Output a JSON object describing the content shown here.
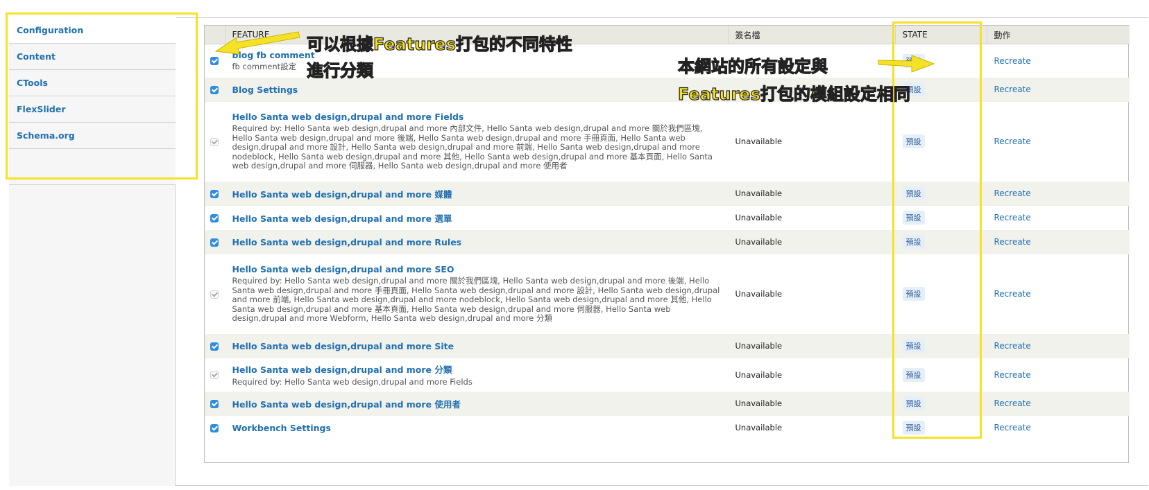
{
  "tabs": [
    {
      "label": "Configuration",
      "active": true
    },
    {
      "label": "Content",
      "active": false
    },
    {
      "label": "CTools",
      "active": false
    },
    {
      "label": "FlexSlider",
      "active": false
    },
    {
      "label": "Schema.org",
      "active": false
    }
  ],
  "table": {
    "headers": {
      "feature": "FEATURE",
      "signature": "簽名檔",
      "state": "STATE",
      "actions": "動作"
    },
    "rows": [
      {
        "checked": true,
        "disabled": false,
        "name": "blog fb comment",
        "desc": "fb comment設定",
        "signature": "",
        "state": "預設",
        "action": "Recreate"
      },
      {
        "checked": true,
        "disabled": false,
        "name": "Blog Settings",
        "desc": "",
        "signature": "",
        "state": "預設",
        "action": "Recreate"
      },
      {
        "checked": true,
        "disabled": true,
        "name": "Hello Santa web design,drupal and more Fields",
        "desc": "Required by: Hello Santa web design,drupal and more 內部文件, Hello Santa web design,drupal and more 關於我們區塊, Hello Santa web design,drupal and more 後端, Hello Santa web design,drupal and more 手冊頁面, Hello Santa web design,drupal and more 設計, Hello Santa web design,drupal and more 前端, Hello Santa web design,drupal and more nodeblock, Hello Santa web design,drupal and more 其他, Hello Santa web design,drupal and more 基本頁面, Hello Santa web design,drupal and more 伺服器, Hello Santa web design,drupal and more 使用者",
        "signature": "Unavailable",
        "state": "預設",
        "action": "Recreate"
      },
      {
        "checked": true,
        "disabled": false,
        "name": "Hello Santa web design,drupal and more 媒體",
        "desc": "",
        "signature": "Unavailable",
        "state": "預設",
        "action": "Recreate"
      },
      {
        "checked": true,
        "disabled": false,
        "name": "Hello Santa web design,drupal and more 選單",
        "desc": "",
        "signature": "Unavailable",
        "state": "預設",
        "action": "Recreate"
      },
      {
        "checked": true,
        "disabled": false,
        "name": "Hello Santa web design,drupal and more Rules",
        "desc": "",
        "signature": "Unavailable",
        "state": "預設",
        "action": "Recreate"
      },
      {
        "checked": true,
        "disabled": true,
        "name": "Hello Santa web design,drupal and more SEO",
        "desc": "Required by: Hello Santa web design,drupal and more 關於我們區塊, Hello Santa web design,drupal and more 後端, Hello Santa web design,drupal and more 手冊頁面, Hello Santa web design,drupal and more 設計, Hello Santa web design,drupal and more 前端, Hello Santa web design,drupal and more nodeblock, Hello Santa web design,drupal and more 其他, Hello Santa web design,drupal and more 基本頁面, Hello Santa web design,drupal and more 伺服器, Hello Santa web design,drupal and more Webform, Hello Santa web design,drupal and more 分類",
        "signature": "Unavailable",
        "state": "預設",
        "action": "Recreate"
      },
      {
        "checked": true,
        "disabled": false,
        "name": "Hello Santa web design,drupal and more Site",
        "desc": "",
        "signature": "Unavailable",
        "state": "預設",
        "action": "Recreate"
      },
      {
        "checked": true,
        "disabled": true,
        "name": "Hello Santa web design,drupal and more 分類",
        "desc": "Required by: Hello Santa web design,drupal and more Fields",
        "signature": "Unavailable",
        "state": "預設",
        "action": "Recreate"
      },
      {
        "checked": true,
        "disabled": false,
        "name": "Hello Santa web design,drupal and more 使用者",
        "desc": "",
        "signature": "Unavailable",
        "state": "預設",
        "action": "Recreate"
      },
      {
        "checked": true,
        "disabled": false,
        "name": "Workbench Settings",
        "desc": "",
        "signature": "Unavailable",
        "state": "預設",
        "action": "Recreate"
      }
    ]
  },
  "annotations": {
    "left_line1": "可以根據Features打包的不同特性",
    "left_line2": "進行分類",
    "right_line1": "本網站的所有設定與",
    "right_line2": "Features打包的模組設定相同"
  },
  "colors": {
    "annotation": "#f5e125",
    "link": "#1f6fb2",
    "header_bg": "#e9e9e1"
  }
}
